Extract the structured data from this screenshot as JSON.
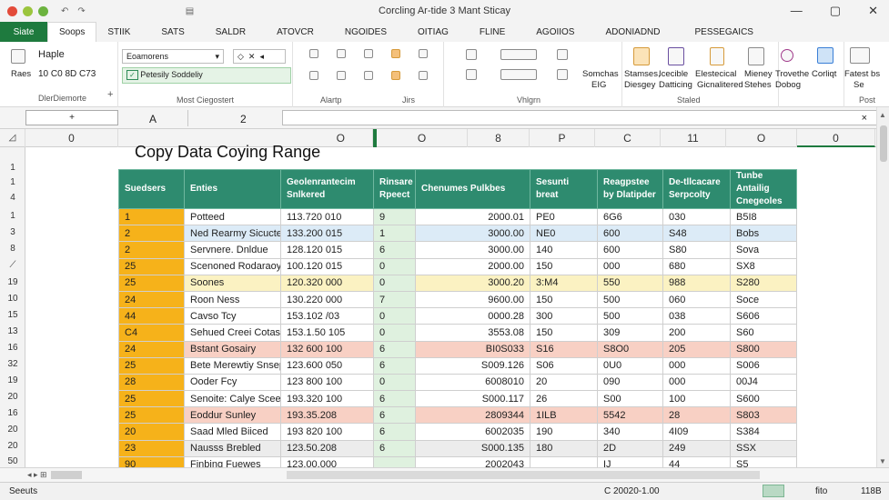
{
  "window": {
    "title": "Corcling Ar-tide 3 Mant Sticay"
  },
  "tabs": [
    "Siate",
    "Soops",
    "STIIK",
    "SATS",
    "SALDR",
    "ATOVCR",
    "NGOIDES",
    "OITIAG",
    "FLINE",
    "AGOIIOS",
    "ADONIADND",
    "PESSEGAICS"
  ],
  "ribbon": {
    "clipboard": {
      "paste": "Raes",
      "label": "DlerDiemorte"
    },
    "font": {
      "name": "Haple",
      "row": "10 C0 8D C73",
      "font_box": "Eoamorens"
    },
    "style_box": "Petesily Soddeliy",
    "group_most": "Most Ciegostert",
    "alignment_label": "Alartp",
    "number_label": "Jirs",
    "vmgm_label": "Vhlgrn",
    "sorting": [
      "Somchas",
      "EIG"
    ],
    "big_buttons": [
      {
        "line1": "Stamses,",
        "line2": "Diesgey"
      },
      {
        "line1": "Icecible",
        "line2": "Datticing"
      },
      {
        "line1": "Elestecical",
        "line2": "Gicnalitered"
      },
      {
        "line1": "Mieney",
        "line2": "Stehes"
      },
      {
        "line1": "Trovethe",
        "line2": "Dobog"
      },
      {
        "line1": "Corliqt",
        "line2": ""
      },
      {
        "line1": "Fatest bs",
        "line2": "Se"
      }
    ],
    "staled_label": "Staled",
    "post_label": "Post"
  },
  "formula_bar": {
    "name_box": "+",
    "col_b": "A",
    "col_c": "2",
    "close": "×"
  },
  "columns": [
    "0",
    "O",
    "O",
    "8",
    "P",
    "C",
    "11",
    "O",
    "0"
  ],
  "rows": [
    "1",
    "1",
    "4",
    "1",
    "3",
    "8",
    "7",
    "19",
    "10",
    "15",
    "13",
    "16",
    "32",
    "19",
    "20",
    "16",
    "20",
    "20",
    "50"
  ],
  "sheet_title": "Copy Data Coying Range",
  "table": {
    "headers": [
      "Suedsers",
      "Enties",
      "Geolenrantecim Snlkered",
      "Rinsare Rpeect",
      "Chenumes Pulkbes",
      "Sesunti breat",
      "Reagpstee by Dlatipder",
      "De-tllcacare Serpcolty",
      "Tunbe Antailig Cnegeoles"
    ],
    "rows": [
      {
        "style": "",
        "cells": [
          "1",
          "Potteed",
          "113.720 010",
          "9",
          "2000.01",
          "PE0",
          "6G6",
          "030",
          "B5I8"
        ]
      },
      {
        "style": "blue",
        "cells": [
          "2",
          "Ned Rearmy Sicucte",
          "133.200 015",
          "1",
          "3000.00",
          "NE0",
          "600",
          "S48",
          "Bobs"
        ]
      },
      {
        "style": "",
        "cells": [
          "2",
          "Servnere. Dnldue",
          "128.120 015",
          "6",
          "3000.00",
          "140",
          "600",
          "S80",
          "Sova"
        ]
      },
      {
        "style": "",
        "cells": [
          "25",
          "Scenoned Rodaraoy",
          "100.120 015",
          "0",
          "2000.00",
          "150",
          "000",
          "680",
          "SX8"
        ]
      },
      {
        "style": "yellow",
        "cells": [
          "25",
          "Soones",
          "120.320 000",
          "0",
          "3000.20",
          "3:M4",
          "550",
          "988",
          "S280"
        ]
      },
      {
        "style": "",
        "cells": [
          "24",
          "Roon Ness",
          "130.220 000",
          "7",
          "9600.00",
          "150",
          "500",
          "060",
          "Soce"
        ]
      },
      {
        "style": "",
        "cells": [
          "44",
          "Cavso Tcy",
          "153.102 /03",
          "0",
          "0000.28",
          "300",
          "500",
          "038",
          "S606"
        ]
      },
      {
        "style": "",
        "cells": [
          "C4",
          "Sehued Creei Cotas",
          "153.1.50 105",
          "0",
          "3553.08",
          "150",
          "309",
          "200",
          "S60"
        ]
      },
      {
        "style": "pink",
        "cells": [
          "24",
          "Bstant Gosairy",
          "132 600 100",
          "6",
          "BI0S033",
          "S16",
          "S8O0",
          "205",
          "S800"
        ]
      },
      {
        "style": "",
        "cells": [
          "25",
          "Bete Merewtiy Snsep",
          "123.600 050",
          "6",
          "S009.126",
          "S06",
          "0U0",
          "000",
          "S006"
        ]
      },
      {
        "style": "",
        "cells": [
          "28",
          "Ooder Fcy",
          "123 800 100",
          "0",
          "6008010",
          "20",
          "090",
          "000",
          "00J4"
        ]
      },
      {
        "style": "",
        "cells": [
          "25",
          "Senoite: Calye Sceer",
          "193.320 100",
          "6",
          "S000.117",
          "26",
          "S00",
          "100",
          "S600"
        ]
      },
      {
        "style": "pink",
        "cells": [
          "25",
          "Eoddur Sunley",
          "193.35.208",
          "6",
          "2809344",
          "1ILB",
          "5542",
          "28",
          "S803"
        ]
      },
      {
        "style": "",
        "cells": [
          "20",
          "Saad Mled Biiced",
          "193 820 100",
          "6",
          "6002035",
          "190",
          "340",
          "4I09",
          "S384"
        ]
      },
      {
        "style": "grey",
        "cells": [
          "23",
          "Nausss Brebled",
          "123.50.208",
          "6",
          "S000.135",
          "180",
          "2D",
          "249",
          "SSX"
        ]
      },
      {
        "style": "",
        "cells": [
          "90",
          "Finbing Fuewes",
          "123.00.000",
          "",
          "2002043",
          "",
          "IJ",
          "44",
          "S5"
        ]
      }
    ]
  },
  "status": {
    "left": "Seeuts",
    "value": "C 20020-1.00",
    "zoom": "fito",
    "right": "118B"
  }
}
